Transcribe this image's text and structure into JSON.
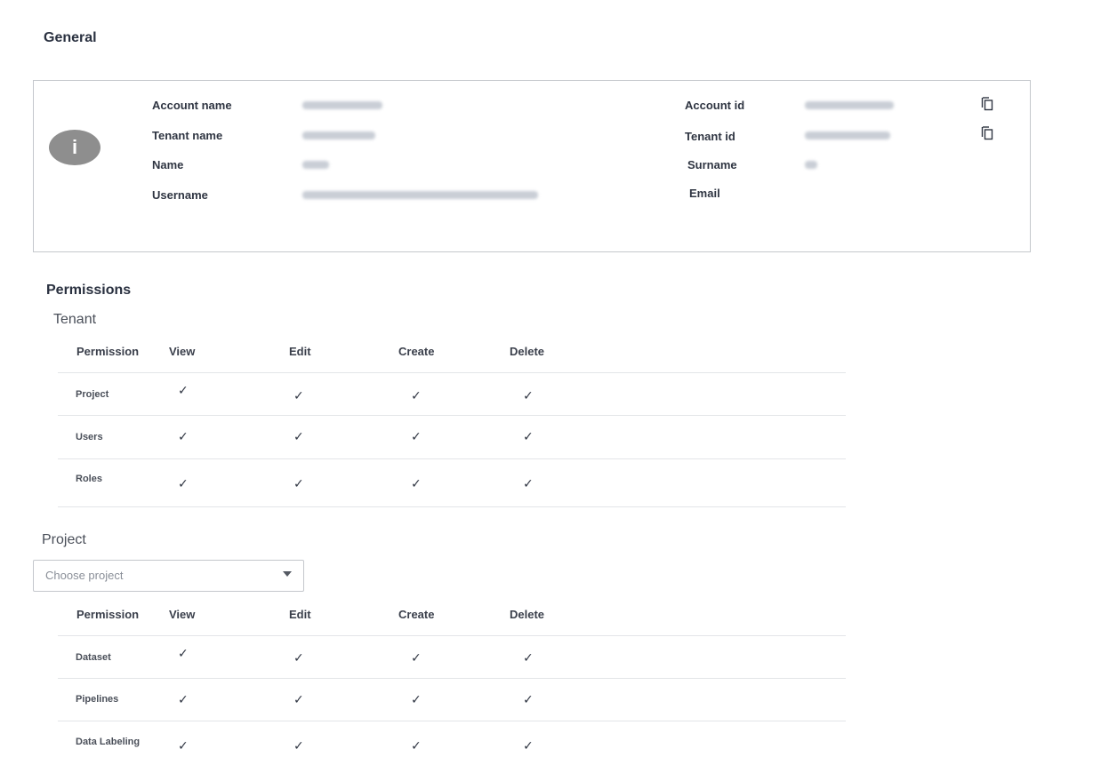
{
  "general": {
    "title": "General",
    "fields_left": [
      {
        "label": "Account name"
      },
      {
        "label": "Tenant name"
      },
      {
        "label": "Name"
      },
      {
        "label": "Username"
      }
    ],
    "fields_right": [
      {
        "label": "Account id"
      },
      {
        "label": "Tenant id"
      },
      {
        "label": "Surname"
      },
      {
        "label": "Email"
      }
    ],
    "info_icon_glyph": "i"
  },
  "permissions": {
    "title": "Permissions",
    "tenant": {
      "title": "Tenant",
      "columns": [
        "Permission",
        "View",
        "Edit",
        "Create",
        "Delete"
      ],
      "rows": [
        {
          "label": "Project",
          "checks": [
            "✓",
            "✓",
            "✓",
            "✓"
          ]
        },
        {
          "label": "Users",
          "checks": [
            "✓",
            "✓",
            "✓",
            "✓"
          ]
        },
        {
          "label": "Roles",
          "checks": [
            "✓",
            "✓",
            "✓",
            "✓"
          ]
        }
      ]
    },
    "project": {
      "title": "Project",
      "select_placeholder": "Choose project",
      "columns": [
        "Permission",
        "View",
        "Edit",
        "Create",
        "Delete"
      ],
      "rows": [
        {
          "label": "Dataset",
          "checks": [
            "✓",
            "✓",
            "✓",
            "✓"
          ]
        },
        {
          "label": "Pipelines",
          "checks": [
            "✓",
            "✓",
            "✓",
            "✓"
          ]
        },
        {
          "label": "Data Labeling",
          "checks": [
            "✓",
            "✓",
            "✓",
            "✓"
          ]
        }
      ]
    }
  },
  "icons": {
    "info": "info-icon",
    "copy": "copy-icon",
    "dropdown": "caret-down-icon"
  }
}
